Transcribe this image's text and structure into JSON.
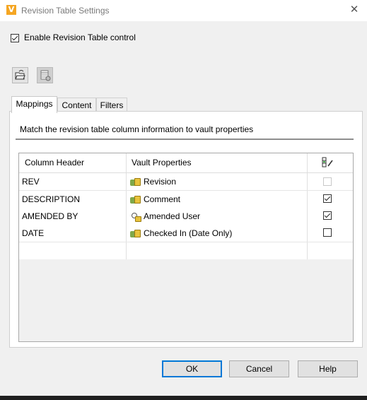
{
  "window": {
    "title": "Revision Table Settings",
    "close_glyph": "✕",
    "logo_letter": "V"
  },
  "enable": {
    "label": "Enable Revision Table control",
    "checked": true
  },
  "toolbar": {
    "buttons": [
      {
        "icon": "folder-open-icon",
        "enabled": true
      },
      {
        "icon": "table-settings-icon",
        "enabled": false
      }
    ]
  },
  "tabs": [
    {
      "label": "Mappings",
      "active": true
    },
    {
      "label": "Content",
      "active": false
    },
    {
      "label": "Filters",
      "active": false
    }
  ],
  "mappings": {
    "instruction": "Match the revision table column information to vault properties",
    "columns": [
      "Column Header",
      "Vault Properties"
    ],
    "rows": [
      {
        "header": "REV",
        "property": "Revision",
        "icon": "property-icon",
        "checked": false,
        "disabled": true
      },
      {
        "header": "DESCRIPTION",
        "property": "Comment",
        "icon": "property-icon",
        "checked": true,
        "disabled": false
      },
      {
        "header": "AMENDED BY",
        "property": "Amended User",
        "icon": "user-property-icon",
        "checked": true,
        "disabled": false
      },
      {
        "header": "DATE",
        "property": "Checked In (Date Only)",
        "icon": "property-icon",
        "checked": false,
        "disabled": false
      }
    ]
  },
  "buttons": {
    "ok": "OK",
    "cancel": "Cancel",
    "help": "Help"
  }
}
